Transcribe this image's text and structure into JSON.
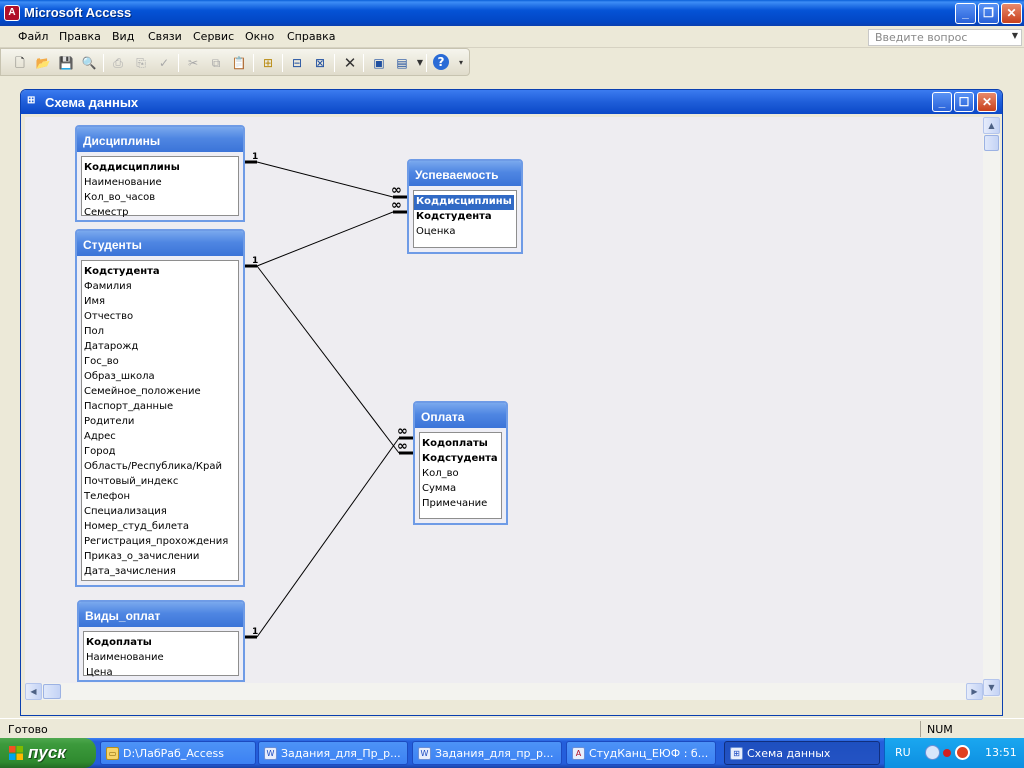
{
  "app": {
    "title": "Microsoft Access",
    "min": "_",
    "max": "❐",
    "close": "✕"
  },
  "menu": {
    "items": [
      "Файл",
      "Правка",
      "Вид",
      "Связи",
      "Сервис",
      "Окно",
      "Справка"
    ],
    "ask_placeholder": "Введите вопрос"
  },
  "toolbar": {
    "icons": [
      "new-icon",
      "open-icon",
      "save-icon",
      "print-preview-icon",
      "print-icon",
      "preview-icon",
      "spelling-icon",
      "cut-icon",
      "copy-icon",
      "paste-icon",
      "show-table-icon",
      "direct-relationships-icon",
      "all-relationships-icon",
      "delete-icon",
      "database-window-icon",
      "new-object-icon",
      "help-icon"
    ]
  },
  "schema_window": {
    "title": "Схема данных"
  },
  "tables": [
    {
      "name": "Дисциплины",
      "fields": [
        {
          "name": "Коддисциплины",
          "pk": true
        },
        {
          "name": "Наименование",
          "pk": false
        },
        {
          "name": "Кол_во_часов",
          "pk": false
        },
        {
          "name": "Семестр",
          "pk": false
        }
      ]
    },
    {
      "name": "Студенты",
      "fields": [
        {
          "name": "Кодстудента",
          "pk": true
        },
        {
          "name": "Фамилия",
          "pk": false
        },
        {
          "name": "Имя",
          "pk": false
        },
        {
          "name": "Отчество",
          "pk": false
        },
        {
          "name": "Пол",
          "pk": false
        },
        {
          "name": "Датарожд",
          "pk": false
        },
        {
          "name": "Гос_во",
          "pk": false
        },
        {
          "name": "Образ_школа",
          "pk": false
        },
        {
          "name": "Семейное_положение",
          "pk": false
        },
        {
          "name": "Паспорт_данные",
          "pk": false
        },
        {
          "name": "Родители",
          "pk": false
        },
        {
          "name": "Адрес",
          "pk": false
        },
        {
          "name": "Город",
          "pk": false
        },
        {
          "name": "Область/Республика/Край",
          "pk": false
        },
        {
          "name": "Почтовый_индекс",
          "pk": false
        },
        {
          "name": "Телефон",
          "pk": false
        },
        {
          "name": "Специализация",
          "pk": false
        },
        {
          "name": "Номер_студ_билета",
          "pk": false
        },
        {
          "name": "Регистрация_прохождения",
          "pk": false
        },
        {
          "name": "Приказ_о_зачислении",
          "pk": false
        },
        {
          "name": "Дата_зачисления",
          "pk": false
        }
      ]
    },
    {
      "name": "Виды_оплат",
      "fields": [
        {
          "name": "Кодоплаты",
          "pk": true
        },
        {
          "name": "Наименование",
          "pk": false
        },
        {
          "name": "Цена",
          "pk": false
        }
      ]
    },
    {
      "name": "Успеваемость",
      "fields": [
        {
          "name": "Коддисциплины",
          "pk": true,
          "selected": true
        },
        {
          "name": "Кодстудента",
          "pk": true
        },
        {
          "name": "Оценка",
          "pk": false
        }
      ]
    },
    {
      "name": "Оплата",
      "fields": [
        {
          "name": "Кодоплаты",
          "pk": true
        },
        {
          "name": "Кодстудента",
          "pk": true
        },
        {
          "name": "Кол_во",
          "pk": false
        },
        {
          "name": "Сумма",
          "pk": false
        },
        {
          "name": "Примечание",
          "pk": false
        }
      ]
    }
  ],
  "relationships": [
    {
      "from": "Дисциплины.Коддисциплины",
      "to": "Успеваемость.Коддисциплины",
      "one_label": "1",
      "many_label": "∞"
    },
    {
      "from": "Студенты.Кодстудента",
      "to": "Успеваемость.Кодстудента",
      "one_label": "1",
      "many_label": "∞"
    },
    {
      "from": "Студенты.Кодстудента",
      "to": "Оплата.Кодстудента",
      "one_label": "1",
      "many_label": "∞"
    },
    {
      "from": "Виды_оплат.Кодоплаты",
      "to": "Оплата.Кодоплаты",
      "one_label": "1",
      "many_label": "∞"
    }
  ],
  "status": {
    "text": "Готово",
    "num": "NUM"
  },
  "taskbar": {
    "start": "пуск",
    "tasks": [
      {
        "label": "D:\\ЛабРаб_Access",
        "active": false
      },
      {
        "label": "Задания_для_Пр_р...",
        "active": false
      },
      {
        "label": "Задания_для_пр_р...",
        "active": false
      },
      {
        "label": "СтудКанц_ЕЮФ : б...",
        "active": false
      },
      {
        "label": "Схема данных",
        "active": true
      }
    ],
    "lang": "RU",
    "clock": "13:51"
  }
}
